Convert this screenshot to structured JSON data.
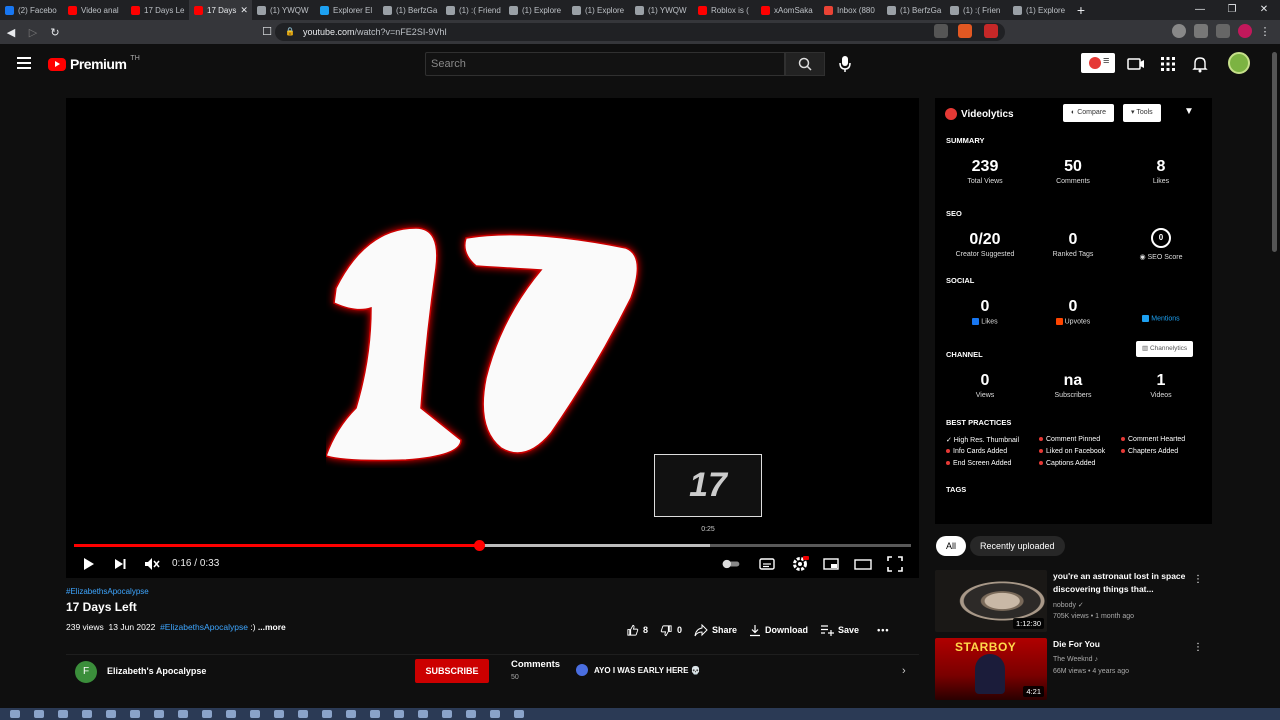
{
  "browser": {
    "tabs": [
      {
        "label": "(2) Facebo",
        "color": "#1877f2"
      },
      {
        "label": "Video anal",
        "color": "#ff0000"
      },
      {
        "label": "17 Days Le",
        "color": "#ff0000"
      },
      {
        "label": "17 Days",
        "color": "#ff0000",
        "active": true
      },
      {
        "label": "(1) YWQW",
        "color": "#9aa0a6"
      },
      {
        "label": "Explorer El",
        "color": "#1da1f2"
      },
      {
        "label": "(1) BerfzGa",
        "color": "#9aa0a6"
      },
      {
        "label": "(1) :( Friend",
        "color": "#9aa0a6"
      },
      {
        "label": "(1) Explore",
        "color": "#9aa0a6"
      },
      {
        "label": "(1) Explore",
        "color": "#9aa0a6"
      },
      {
        "label": "(1) YWQW",
        "color": "#9aa0a6"
      },
      {
        "label": "Roblox is (",
        "color": "#ff0000"
      },
      {
        "label": "xAomSaka",
        "color": "#ff0000"
      },
      {
        "label": "Inbox (880",
        "color": "#ea4335"
      },
      {
        "label": "(1) BerfzGa",
        "color": "#9aa0a6"
      },
      {
        "label": "(1) :( Frien",
        "color": "#9aa0a6"
      },
      {
        "label": "(1) Explore",
        "color": "#9aa0a6"
      }
    ],
    "new_tab": "+",
    "url_host": "youtube.com",
    "url_path": "/watch?v=nFE2SI-9VhI"
  },
  "header": {
    "logo_word": "Premium",
    "logo_country": "TH",
    "search_placeholder": "Search"
  },
  "player": {
    "big_number": "17",
    "preview_number": "17",
    "preview_time": "0:25",
    "time_current": "0:16",
    "time_total": "0:33",
    "progress": 0.485,
    "buffer_end": 0.76
  },
  "video": {
    "hashtag": "#ElizabethsApocalypse",
    "title": "17 Days Left",
    "views": "239 views",
    "date": "13 Jun 2022",
    "desc_tag": "#ElizabethsApocalypse",
    "desc_tail": " :) ",
    "more": "...more",
    "likes": "8",
    "dislikes": "0",
    "share": "Share",
    "download": "Download",
    "save": "Save"
  },
  "channel": {
    "initial": "F",
    "name": "Elizabeth's Apocalypse",
    "subscribe": "SUBSCRIBE",
    "comments_label": "Comments",
    "comments_count": "50",
    "first_comment": "AYO I WAS EARLY HERE 💀"
  },
  "videolytics": {
    "title": "Videolytics",
    "compare": "Compare",
    "tools": "Tools",
    "summary": {
      "label": "SUMMARY",
      "items": [
        {
          "value": "239",
          "label": "Total Views"
        },
        {
          "value": "50",
          "label": "Comments"
        },
        {
          "value": "8",
          "label": "Likes"
        }
      ]
    },
    "seo": {
      "label": "SEO",
      "items": [
        {
          "value": "0/20",
          "label": "Creator Suggested"
        },
        {
          "value": "0",
          "label": "Ranked Tags"
        },
        {
          "value": "0",
          "label": "SEO Score"
        }
      ]
    },
    "social": {
      "label": "SOCIAL",
      "items": [
        {
          "value": "0",
          "label": "Likes"
        },
        {
          "value": "0",
          "label": "Upvotes"
        },
        {
          "value": "",
          "label": "Mentions"
        }
      ]
    },
    "channelytics_btn": "Channelytics",
    "channel": {
      "label": "CHANNEL",
      "items": [
        {
          "value": "0",
          "label": "Views"
        },
        {
          "value": "na",
          "label": "Subscribers"
        },
        {
          "value": "1",
          "label": "Videos"
        }
      ]
    },
    "best_practices": {
      "label": "BEST PRACTICES",
      "col1": [
        "✓ High Res. Thumbnail",
        "Info Cards Added",
        "End Screen Added"
      ],
      "col2": [
        "Comment Pinned",
        "Liked on Facebook",
        "Captions Added"
      ],
      "col3": [
        "Comment Hearted",
        "Chapters Added"
      ]
    },
    "tags_label": "TAGS"
  },
  "chips": {
    "all": "All",
    "recent": "Recently uploaded"
  },
  "recommendations": [
    {
      "title": "you're an astronaut lost in space discovering things that...",
      "channel": "nobody",
      "stats": "705K views • 1 month ago",
      "duration": "1:12:30"
    },
    {
      "title": "Die For You",
      "channel": "The Weeknd",
      "stats": "66M views • 4 years ago",
      "duration": "4:21",
      "thumb_text": "STARBOY"
    }
  ]
}
